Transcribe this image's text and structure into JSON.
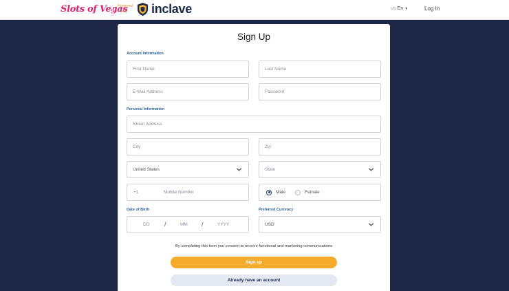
{
  "header": {
    "brand": "Slots of Vegas",
    "powered_by": "Powered by",
    "partner": "inclave",
    "lang_code": "US",
    "lang_label": "En",
    "login": "Log In"
  },
  "form": {
    "title": "Sign Up",
    "account_section": "Account Information",
    "first_name_placeholder": "First Name",
    "last_name_placeholder": "Last Name",
    "email_placeholder": "E-Mail Address",
    "password_placeholder": "Password",
    "personal_section": "Personal Information",
    "street_placeholder": "Street Address",
    "city_placeholder": "City",
    "zip_placeholder": "Zip",
    "country_value": "United States",
    "state_placeholder": "State",
    "phone_prefix": "+1",
    "phone_placeholder": "Mobile Number",
    "gender_male": "Male",
    "gender_female": "Female",
    "gender_selected": "Male",
    "dob_label": "Date of Birth",
    "dob_day": "DD",
    "dob_month": "MM",
    "dob_year": "YYYY",
    "dob_sep": "/",
    "currency_label": "Preferred Currency",
    "currency_value": "USD",
    "consent": "By completing this form you consent to receive functional and marketing communications",
    "signup_button": "Sign up",
    "existing_account_button": "Already have an account"
  },
  "colors": {
    "background": "#1e2645",
    "accent": "#f6ab2d",
    "section_label": "#2a5c9e",
    "brand": "#d6246e"
  }
}
